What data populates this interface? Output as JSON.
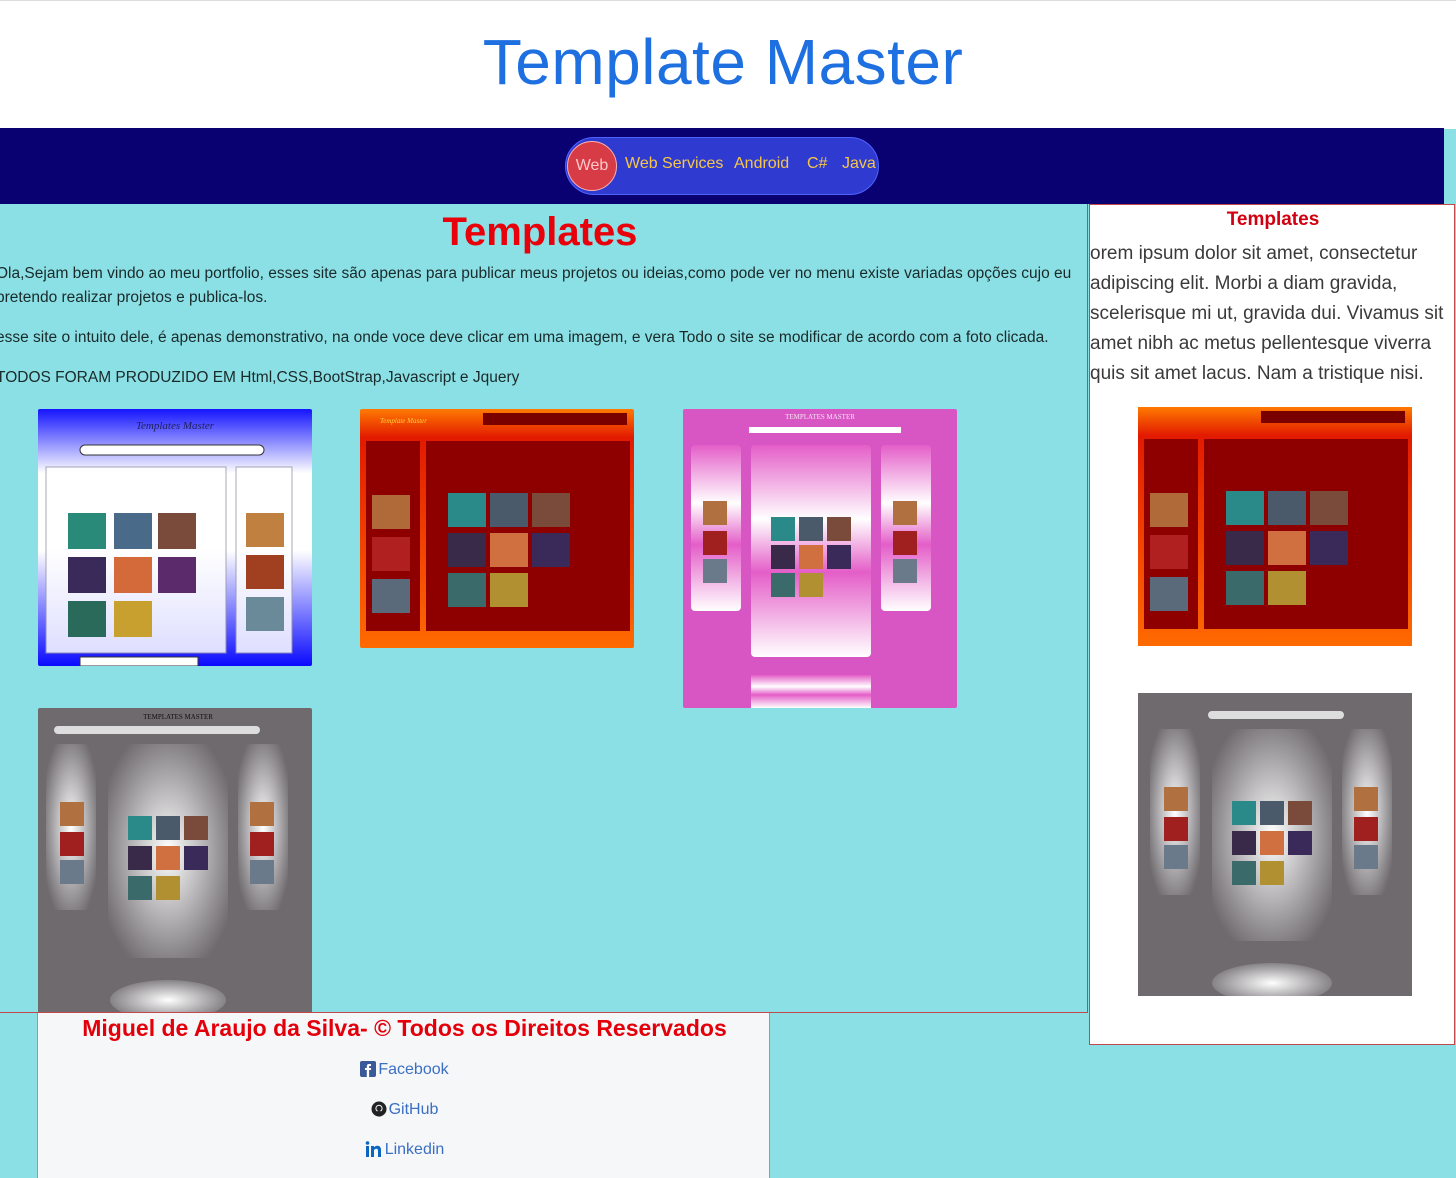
{
  "header": {
    "title": "Template Master"
  },
  "nav": {
    "items": [
      {
        "label": "Web",
        "active": true
      },
      {
        "label": "Web Services"
      },
      {
        "label": "Android"
      },
      {
        "label": "C#"
      },
      {
        "label": "Java"
      }
    ]
  },
  "main": {
    "heading": "Templates",
    "paragraphs": [
      "Ola,Sejam bem vindo ao meu portfolio, esses site são apenas para publicar meus projetos ou ideias,como pode ver no menu existe variadas opções cujo eu pretendo realizar projetos e publica-los.",
      "esse site o intuito dele, é apenas demonstrativo, na onde voce deve clicar em uma imagem, e vera Todo o site se modificar de acordo com a foto clicada.",
      "TODOS FORAM PRODUZIDO EM Html,CSS,BootStrap,Javascript e Jquery"
    ],
    "thumbnails": [
      {
        "name": "blue-template",
        "title": "Templates Master",
        "theme": "blue"
      },
      {
        "name": "red-template",
        "title": "Template Master",
        "theme": "red"
      },
      {
        "name": "pink-template",
        "title": "TEMPLATES MASTER",
        "theme": "pink"
      },
      {
        "name": "gray-template",
        "title": "TEMPLATES MASTER",
        "theme": "gray"
      }
    ]
  },
  "sidebar": {
    "heading": "Templates",
    "text": "orem ipsum dolor sit amet, consectetur adipiscing elit. Morbi a diam gravida, scelerisque mi ut, gravida dui. Vivamus sit amet nibh ac metus pellentesque viverra quis sit amet lacus. Nam a tristique nisi."
  },
  "footer": {
    "copyright": "Miguel de Araujo da Silva- © Todos os Direitos Reservados",
    "links": [
      {
        "label": "Facebook",
        "icon": "facebook-icon"
      },
      {
        "label": "GitHub",
        "icon": "github-icon"
      },
      {
        "label": "Linkedin",
        "icon": "linkedin-icon"
      }
    ]
  },
  "colors": {
    "title": "#1e6fe0",
    "nav_bg": "#090071",
    "nav_pill": "#2f3bd0",
    "nav_text": "#f6c64a",
    "active": "#d63b46",
    "heading_red": "#e8000b",
    "page_bg": "#8be0e5"
  }
}
